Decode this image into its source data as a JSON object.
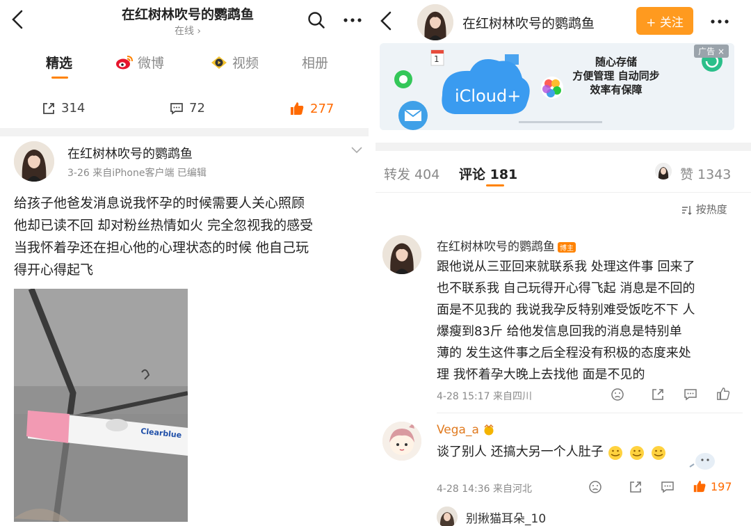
{
  "left": {
    "header": {
      "title": "在红树林吹号的鹦鹉鱼",
      "status": "在线 ›"
    },
    "tabs": [
      {
        "label": "精选"
      },
      {
        "label": "微博"
      },
      {
        "label": "视频"
      },
      {
        "label": "相册"
      }
    ],
    "stats": {
      "reposts": "314",
      "comments": "72",
      "likes": "277"
    },
    "post": {
      "author": "在红树林吹号的鹦鹉鱼",
      "meta": "3-26  来自iPhone客户端  已编辑",
      "lines": [
        "给孩子他爸发消息说我怀孕的时候需要人关心照顾",
        "他却已读不回 却对粉丝热情如火 完全忽视我的感受",
        "当我怀着孕还在担心他的心理状态的时候 他自己玩",
        "得开心得起飞"
      ],
      "photo": {
        "brand": "Clearblue"
      }
    }
  },
  "right": {
    "header": {
      "name": "在红树林吹号的鹦鹉鱼",
      "follow_label": "+ 关注"
    },
    "ad": {
      "tag": "广告 ×",
      "product": "iCloud+",
      "line1": "随心存储",
      "line2": "方便管理 自动同步",
      "line3": "效率有保障",
      "badge_count": "1"
    },
    "tabs": {
      "repost": "转发 404",
      "comment": "评论 181",
      "like": "赞 1343"
    },
    "sort_label": "按热度",
    "comments": [
      {
        "name": "在红树林吹号的鹦鹉鱼",
        "badge": "博主",
        "lines": [
          "跟他说从三亚回来就联系我 处理这件事 回来了",
          "也不联系我 自己玩得开心得飞起 消息是不回的",
          "面是不见我的 我说我孕反特别难受饭吃不下 人",
          "爆瘦到83斤 给他发信息回我的消息是特别单",
          "薄的 发生这件事之后全程没有积极的态度来处",
          "理 我怀着孕大晚上去找他 面是不见的"
        ],
        "meta": "4-28 15:17  来自四川"
      },
      {
        "name": "Vega_a",
        "text": "谈了别人 还搞大另一个人肚子",
        "meta": "4-28 14:36  来自河北",
        "likes": "197"
      },
      {
        "name": "别揪猫耳朵_10"
      }
    ]
  }
}
